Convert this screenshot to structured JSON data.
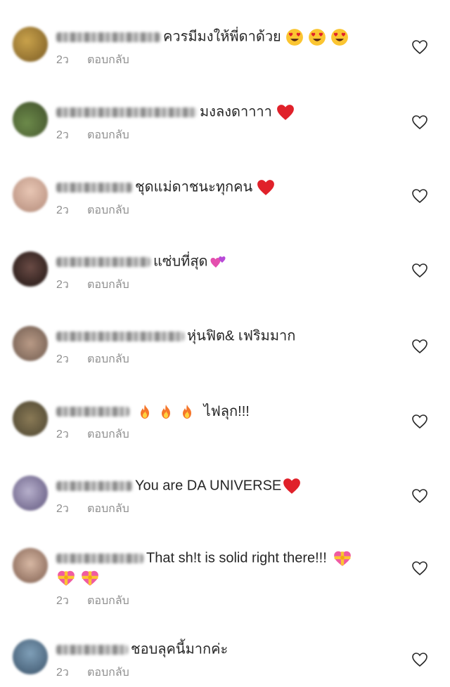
{
  "comments": [
    {
      "text": "ควรมีมงให้พี่ดาด้วย",
      "time": "2ว",
      "reply": "ตอบกลับ",
      "emoji": [
        "heart-eyes-icon",
        "heart-eyes-icon",
        "heart-eyes-icon"
      ]
    },
    {
      "text": "มงลงดาาาา",
      "time": "2ว",
      "reply": "ตอบกลับ",
      "emoji": [
        "red-heart-icon"
      ]
    },
    {
      "text": "ชุดแม่ดาชนะทุกคน",
      "time": "2ว",
      "reply": "ตอบกลับ",
      "emoji": [
        "red-heart-icon"
      ]
    },
    {
      "text": "แซ่บที่สุด",
      "time": "2ว",
      "reply": "ตอบกลับ",
      "emoji": [
        "two-hearts-icon"
      ]
    },
    {
      "text": "หุ่นฟิต& เฟริมมาก",
      "time": "2ว",
      "reply": "ตอบกลับ",
      "emoji": []
    },
    {
      "text": "ไฟลุก!!!",
      "time": "2ว",
      "reply": "ตอบกลับ",
      "emoji": [
        "fire-icon",
        "fire-icon",
        "fire-icon"
      ]
    },
    {
      "text": "You are DA UNIVERSE",
      "time": "2ว",
      "reply": "ตอบกลับ",
      "emoji": [
        "red-heart-icon"
      ]
    },
    {
      "text": "That sh!t is solid right there!!!",
      "time": "2ว",
      "reply": "ตอบกลับ",
      "emoji": [
        "heart-ribbon-icon",
        "heart-ribbon-icon",
        "heart-ribbon-icon"
      ]
    },
    {
      "text": "ชอบลุคนี้มากค่ะ",
      "time": "2ว",
      "reply": "ตอบกลับ",
      "emoji": []
    }
  ],
  "colors": {
    "text": "#262626",
    "meta": "#8e8e8e",
    "heart": "#e0212a"
  }
}
